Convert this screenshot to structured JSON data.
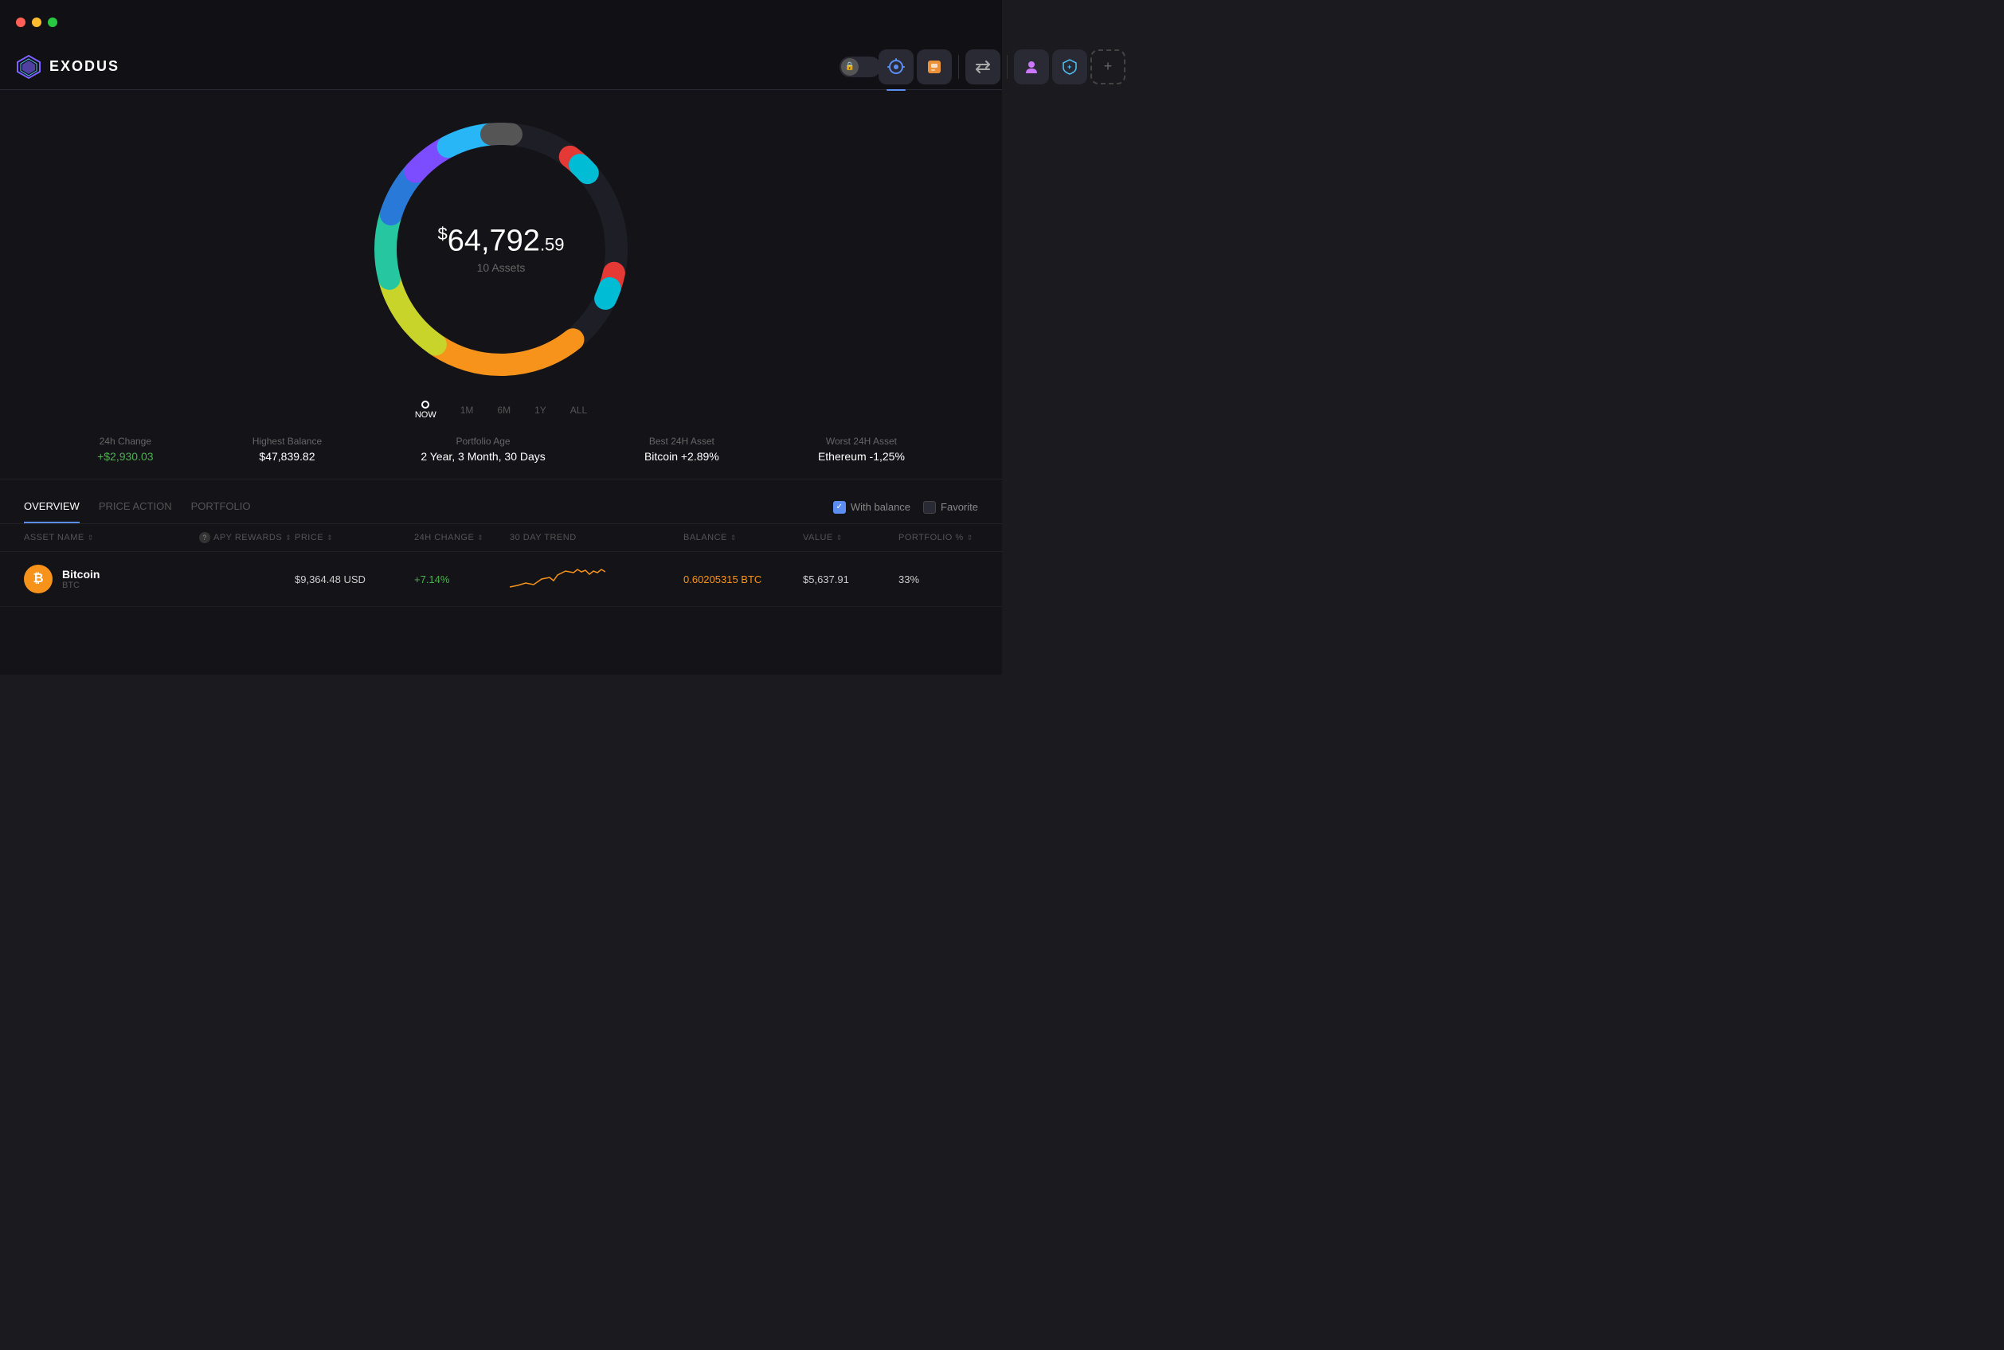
{
  "app": {
    "title": "EXODUS",
    "logo_char": "⟁"
  },
  "titlebar": {
    "lights": [
      "red",
      "yellow",
      "green"
    ]
  },
  "nav": {
    "center_buttons": [
      {
        "id": "portfolio",
        "label": "Portfolio",
        "icon": "⊙",
        "active": true
      },
      {
        "id": "nft",
        "label": "NFT",
        "icon": "🟧"
      },
      {
        "id": "exchange",
        "label": "Exchange",
        "icon": "⇄"
      },
      {
        "id": "characters",
        "label": "Characters",
        "icon": "👾"
      },
      {
        "id": "shield",
        "label": "Shield",
        "icon": "🛡"
      },
      {
        "id": "add",
        "label": "Add",
        "icon": "+"
      }
    ],
    "right_icons": [
      "lock",
      "history",
      "settings",
      "grid"
    ]
  },
  "portfolio": {
    "total_amount": "64,792",
    "total_cents": ".59",
    "total_dollar": "$",
    "asset_count": "10 Assets",
    "time_options": [
      "NOW",
      "1M",
      "6M",
      "1Y",
      "ALL"
    ],
    "active_time": "NOW"
  },
  "stats": [
    {
      "label": "24h Change",
      "value": "+$2,930.03",
      "positive": true
    },
    {
      "label": "Highest Balance",
      "value": "$47,839.82",
      "positive": false
    },
    {
      "label": "Portfolio Age",
      "value": "2 Year, 3 Month, 30 Days",
      "positive": false
    },
    {
      "label": "Best 24H Asset",
      "value": "Bitcoin +2.89%",
      "positive": false
    },
    {
      "label": "Worst 24H Asset",
      "value": "Ethereum -1,25%",
      "positive": false
    }
  ],
  "table": {
    "tabs": [
      "OVERVIEW",
      "PRICE ACTION",
      "PORTFOLIO"
    ],
    "active_tab": "OVERVIEW",
    "filters": [
      {
        "label": "With balance",
        "checked": true
      },
      {
        "label": "Favorite",
        "checked": false
      }
    ],
    "columns": [
      {
        "label": "ASSET NAME",
        "sortable": true
      },
      {
        "label": "APY REWARDS",
        "sortable": true,
        "info": true
      },
      {
        "label": "PRICE",
        "sortable": true
      },
      {
        "label": "24H CHANGE",
        "sortable": true
      },
      {
        "label": "30 DAY TREND",
        "sortable": false
      },
      {
        "label": "BALANCE",
        "sortable": true
      },
      {
        "label": "VALUE",
        "sortable": true
      },
      {
        "label": "PORTFOLIO %",
        "sortable": true
      }
    ],
    "rows": [
      {
        "name": "Bitcoin",
        "ticker": "BTC",
        "icon_color": "#f7931a",
        "icon_char": "₿",
        "apy": "",
        "price": "$9,364.48 USD",
        "change": "+7.14%",
        "change_positive": true,
        "balance": "0.60205315 BTC",
        "balance_colored": true,
        "value": "$5,637.91",
        "portfolio": "33%"
      }
    ]
  },
  "colors": {
    "accent_blue": "#5b8ef0",
    "positive_green": "#4caf50",
    "bitcoin_orange": "#f7931a",
    "bg_dark": "#141418",
    "bg_darker": "#111115"
  }
}
